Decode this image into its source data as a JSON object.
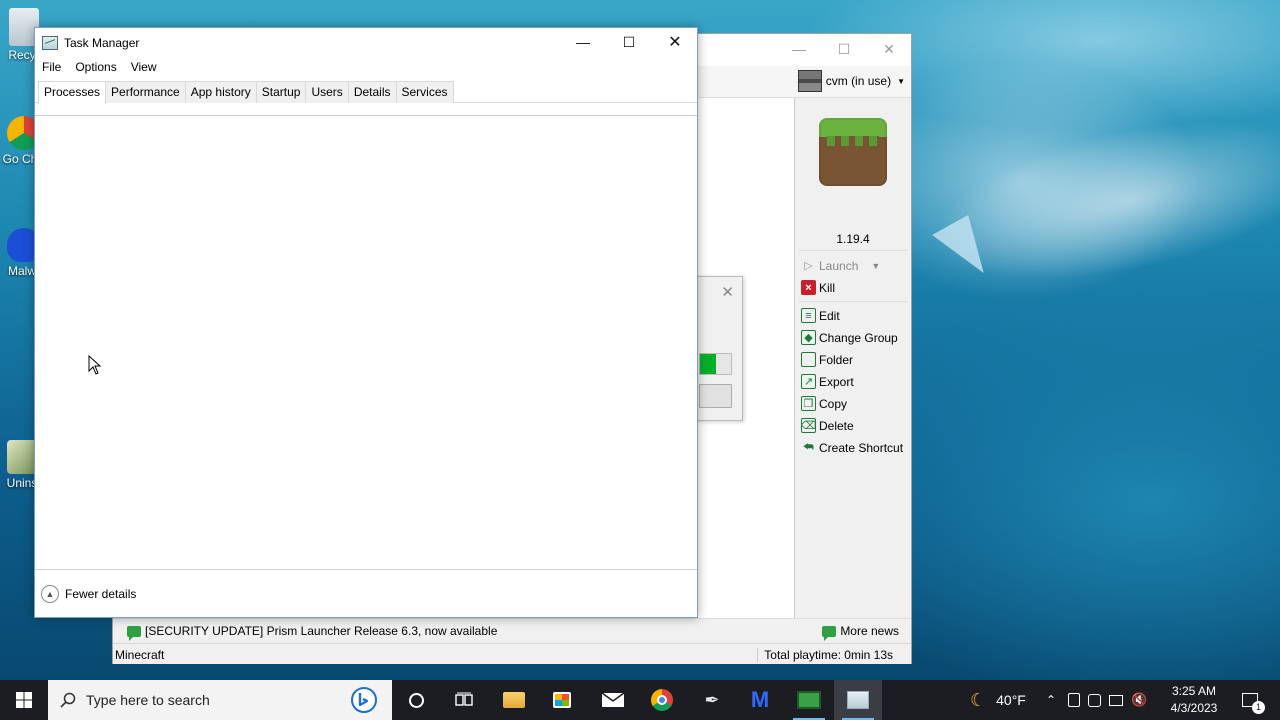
{
  "desktop": {
    "icons": [
      {
        "label": "Recy",
        "name": "desktop-icon-recycle-bin"
      },
      {
        "label": "Go Chr",
        "name": "desktop-icon-chrome"
      },
      {
        "label": "Malw",
        "name": "desktop-icon-malwarebytes"
      },
      {
        "label": "Unins",
        "name": "desktop-icon-uninstall"
      }
    ]
  },
  "prism": {
    "account": "cvm (in use)",
    "version": "1.19.4",
    "actions": {
      "launch": "Launch",
      "kill": "Kill",
      "edit": "Edit",
      "change_group": "Change Group",
      "folder": "Folder",
      "export": "Export",
      "copy": "Copy",
      "delete": "Delete",
      "create_shortcut": "Create Shortcut"
    },
    "news": "[SECURITY UPDATE] Prism Launcher Release 6.3, now available",
    "more_news": "More news",
    "status_left": "Minecraft",
    "status_right": "Total playtime: 0min 13s"
  },
  "dialog": {
    "progress_fraction": 0.5,
    "progress_color": "#06b025"
  },
  "task_manager": {
    "title": "Task Manager",
    "menus": [
      "File",
      "Options",
      "View"
    ],
    "tabs": [
      "Processes",
      "Performance",
      "App history",
      "Startup",
      "Users",
      "Details",
      "Services"
    ],
    "active_tab": "Processes",
    "fewer_details": "Fewer details"
  },
  "taskbar": {
    "search_placeholder": "Type here to search",
    "weather": "40°F",
    "time": "3:25 AM",
    "date": "4/3/2023",
    "notification_count": "1",
    "accent": "#76b9ed"
  }
}
